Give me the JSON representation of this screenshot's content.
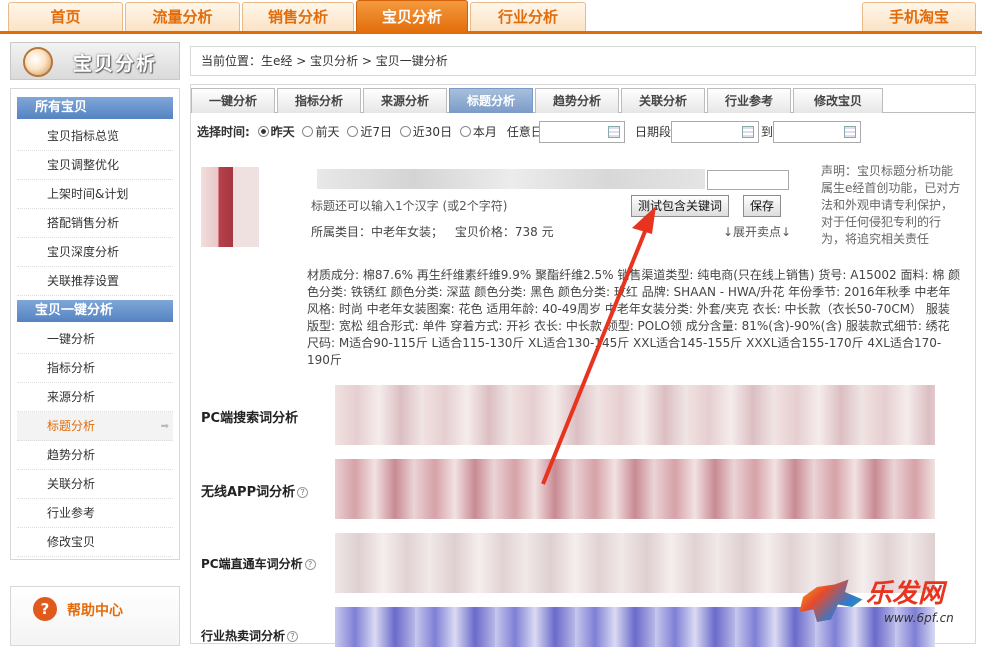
{
  "top_nav": {
    "tabs": [
      "首页",
      "流量分析",
      "销售分析",
      "宝贝分析",
      "行业分析"
    ],
    "active": "宝贝分析",
    "mobile": "手机淘宝"
  },
  "sidebar": {
    "title": "宝贝分析",
    "group1": "所有宝贝",
    "group1_items": [
      "宝贝指标总览",
      "宝贝调整优化",
      "上架时间&计划",
      "搭配销售分析",
      "宝贝深度分析",
      "关联推荐设置"
    ],
    "group2": "宝贝一键分析",
    "group2_items": [
      "一键分析",
      "指标分析",
      "来源分析",
      "标题分析",
      "趋势分析",
      "关联分析",
      "行业参考",
      "修改宝贝"
    ],
    "active_item": "标题分析",
    "help": "帮助中心"
  },
  "breadcrumb": "当前位置：生e经 > 宝贝分析 > 宝贝一键分析",
  "subtabs": [
    "一键分析",
    "指标分析",
    "来源分析",
    "标题分析",
    "趋势分析",
    "关联分析",
    "行业参考",
    "修改宝贝"
  ],
  "active_subtab": "标题分析",
  "time_select": {
    "label": "选择时间:",
    "options": [
      "昨天",
      "前天",
      "近7日",
      "近30日",
      "本月"
    ],
    "selected": "昨天",
    "any_day": "任意日",
    "period": "日期段",
    "to": "到"
  },
  "product": {
    "hint": "标题还可以输入1个汉字 (或2个字符)",
    "test_button": "测试包含关键词",
    "save_button": "保存",
    "category": "所属类目：中老年女装；",
    "price": "宝贝价格：738 元",
    "expand": "↓展开卖点↓",
    "notice": "声明：宝贝标题分析功能属生e经首创功能，已对方法和外观申请专利保护，对于任何侵犯专利的行为，将追究相关责任",
    "attributes": "材质成分: 棉87.6% 再生纤维素纤维9.9% 聚酯纤维2.5%  销售渠道类型: 纯电商(只在线上销售)  货号: A15002  面料: 棉  颜色分类: 铁锈红  颜色分类: 深蓝  颜色分类: 黑色  颜色分类: 玫红  品牌: SHAAN - HWA/升花  年份季节: 2016年秋季  中老年风格: 时尚  中老年女装图案: 花色  适用年龄: 40-49周岁  中老年女装分类: 外套/夹克  衣长: 中长款（衣长50-70CM）  服装版型: 宽松  组合形式: 单件  穿着方式: 开衫  衣长: 中长款  领型: POLO领  成分含量: 81%(含)-90%(含)  服装款式细节: 绣花  尺码: M适合90-115斤  L适合115-130斤  XL适合130-145斤  XXL适合145-155斤  XXXL适合155-170斤  4XL适合170-190斤"
  },
  "analysis_sections": [
    "PC端搜索词分析",
    "无线APP词分析",
    "PC端直通车词分析",
    "行业热卖词分析"
  ],
  "watermark": {
    "text": "乐发网",
    "url": "www.6pf.cn"
  },
  "colors": {
    "accent": "#e36c0a",
    "sidebar_group": "#5583c2",
    "arrow": "#e8331f"
  }
}
